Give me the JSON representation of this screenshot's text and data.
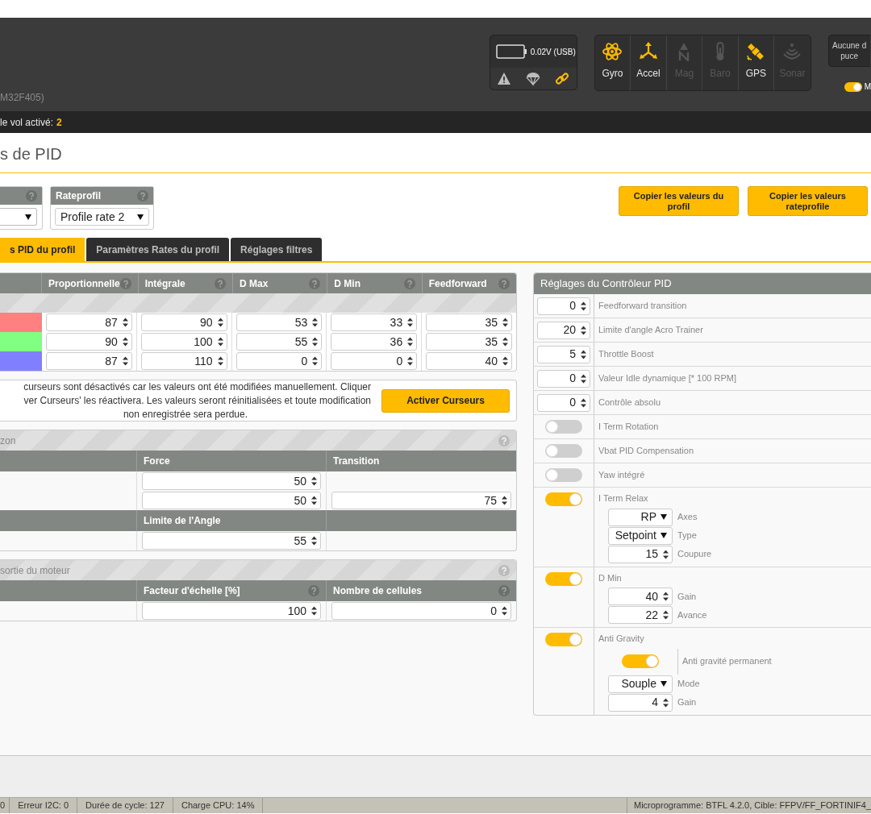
{
  "header": {
    "board_suffix": "M32F405)",
    "battery_reading": "0.02V (USB)",
    "status_icons": [
      {
        "kind": "warning",
        "active": false
      },
      {
        "kind": "parachute",
        "active": false
      },
      {
        "kind": "link",
        "active": true
      }
    ],
    "sensors": [
      {
        "kind": "gyro",
        "label": "Gyro",
        "active": true
      },
      {
        "kind": "accel",
        "label": "Accel",
        "active": true
      },
      {
        "kind": "mag",
        "label": "Mag",
        "active": false
      },
      {
        "kind": "baro",
        "label": "Baro",
        "active": false
      },
      {
        "kind": "gps",
        "label": "GPS",
        "active": true
      },
      {
        "kind": "sonar",
        "label": "Sonar",
        "active": false
      }
    ],
    "port_box": [
      "Aucune d",
      "puce"
    ],
    "mode_toggle": {
      "label": "M",
      "on": true
    }
  },
  "profile_bar": {
    "label": "le vol activé:",
    "value": "2"
  },
  "page_title": "s de PID",
  "rate_profile": {
    "label": "Rateprofil",
    "value": "Profile rate 2"
  },
  "copy_buttons": [
    "Copier les valeurs du profil",
    "Copier les valeurs rateprofile"
  ],
  "tabs": [
    {
      "label": "s PID du profil",
      "selected": true
    },
    {
      "label": "Paramètres Rates du profil",
      "selected": false
    },
    {
      "label": "Réglages filtres",
      "selected": false
    }
  ],
  "pid_table": {
    "columns": [
      "Proportionnelle",
      "Intégrale",
      "D Max",
      "D Min",
      "Feedforward"
    ],
    "rows": [
      {
        "color": "#ff8080",
        "values": [
          "87",
          "90",
          "53",
          "33",
          "35"
        ]
      },
      {
        "color": "#80ff80",
        "values": [
          "90",
          "100",
          "55",
          "36",
          "35"
        ]
      },
      {
        "color": "#8080ff",
        "values": [
          "87",
          "110",
          "0",
          "0",
          "40"
        ]
      }
    ]
  },
  "slider_notice": {
    "lines": [
      "curseurs sont désactivés car les valeurs ont été modifiées manuellement. Cliquer",
      "ver Curseurs' les réactivera. Les valeurs seront réinitialisées et toute modification",
      "non enregistrée sera perdue."
    ],
    "button": "Activer Curseurs"
  },
  "horizon_panel": {
    "title": "zon",
    "columns": [
      "Force",
      "Transition"
    ],
    "rows": [
      {
        "force": "50"
      },
      {
        "force": "50",
        "transition": "75"
      }
    ],
    "angle_column": "Limite de l'Angle",
    "angle_value": "55"
  },
  "motor_panel": {
    "title": "sortie du moteur",
    "columns": [
      {
        "label": "Facteur d'échelle [%]",
        "value": "100"
      },
      {
        "label": "Nombre de cellules",
        "value": "0"
      }
    ]
  },
  "pid_controller": {
    "title": "Réglages du Contrôleur PID",
    "rows": [
      {
        "kind": "number",
        "value": "0",
        "label": "Feedforward transition"
      },
      {
        "kind": "number",
        "value": "20",
        "label": "Limite d'angle Acro Trainer"
      },
      {
        "kind": "number",
        "value": "5",
        "label": "Throttle Boost"
      },
      {
        "kind": "number",
        "value": "0",
        "label": "Valeur Idle dynamique [* 100 RPM]"
      },
      {
        "kind": "number",
        "value": "0",
        "label": "Contrôle absolu"
      },
      {
        "kind": "toggle",
        "on": false,
        "label": "I Term Rotation"
      },
      {
        "kind": "toggle",
        "on": false,
        "label": "Vbat PID Compensation"
      },
      {
        "kind": "toggle",
        "on": false,
        "label": "Yaw intégré"
      },
      {
        "kind": "group",
        "on": true,
        "label": "I Term Relax",
        "items": [
          {
            "kind": "select",
            "value": "RP",
            "label": "Axes"
          },
          {
            "kind": "select",
            "value": "Setpoint",
            "label": "Type"
          },
          {
            "kind": "number",
            "value": "15",
            "label": "Coupure"
          }
        ]
      },
      {
        "kind": "group",
        "on": true,
        "label": "D Min",
        "items": [
          {
            "kind": "number",
            "value": "40",
            "label": "Gain"
          },
          {
            "kind": "number",
            "value": "22",
            "label": "Avance"
          }
        ]
      },
      {
        "kind": "group",
        "on": true,
        "label": "Anti Gravity",
        "items": [
          {
            "kind": "toggle",
            "on": true,
            "label": "Anti gravité permanent"
          },
          {
            "kind": "select",
            "value": "Souple",
            "label": "Mode"
          },
          {
            "kind": "number",
            "value": "4",
            "label": "Gain"
          }
        ]
      }
    ]
  },
  "status_bar": {
    "items": [
      "0",
      "Erreur I2C: 0",
      "Durée de cycle: 127",
      "Charge CPU: 14%"
    ],
    "firmware": "Microprogramme: BTFL 4.2.0, Cible: FFPV/FF_FORTINIF4_"
  }
}
